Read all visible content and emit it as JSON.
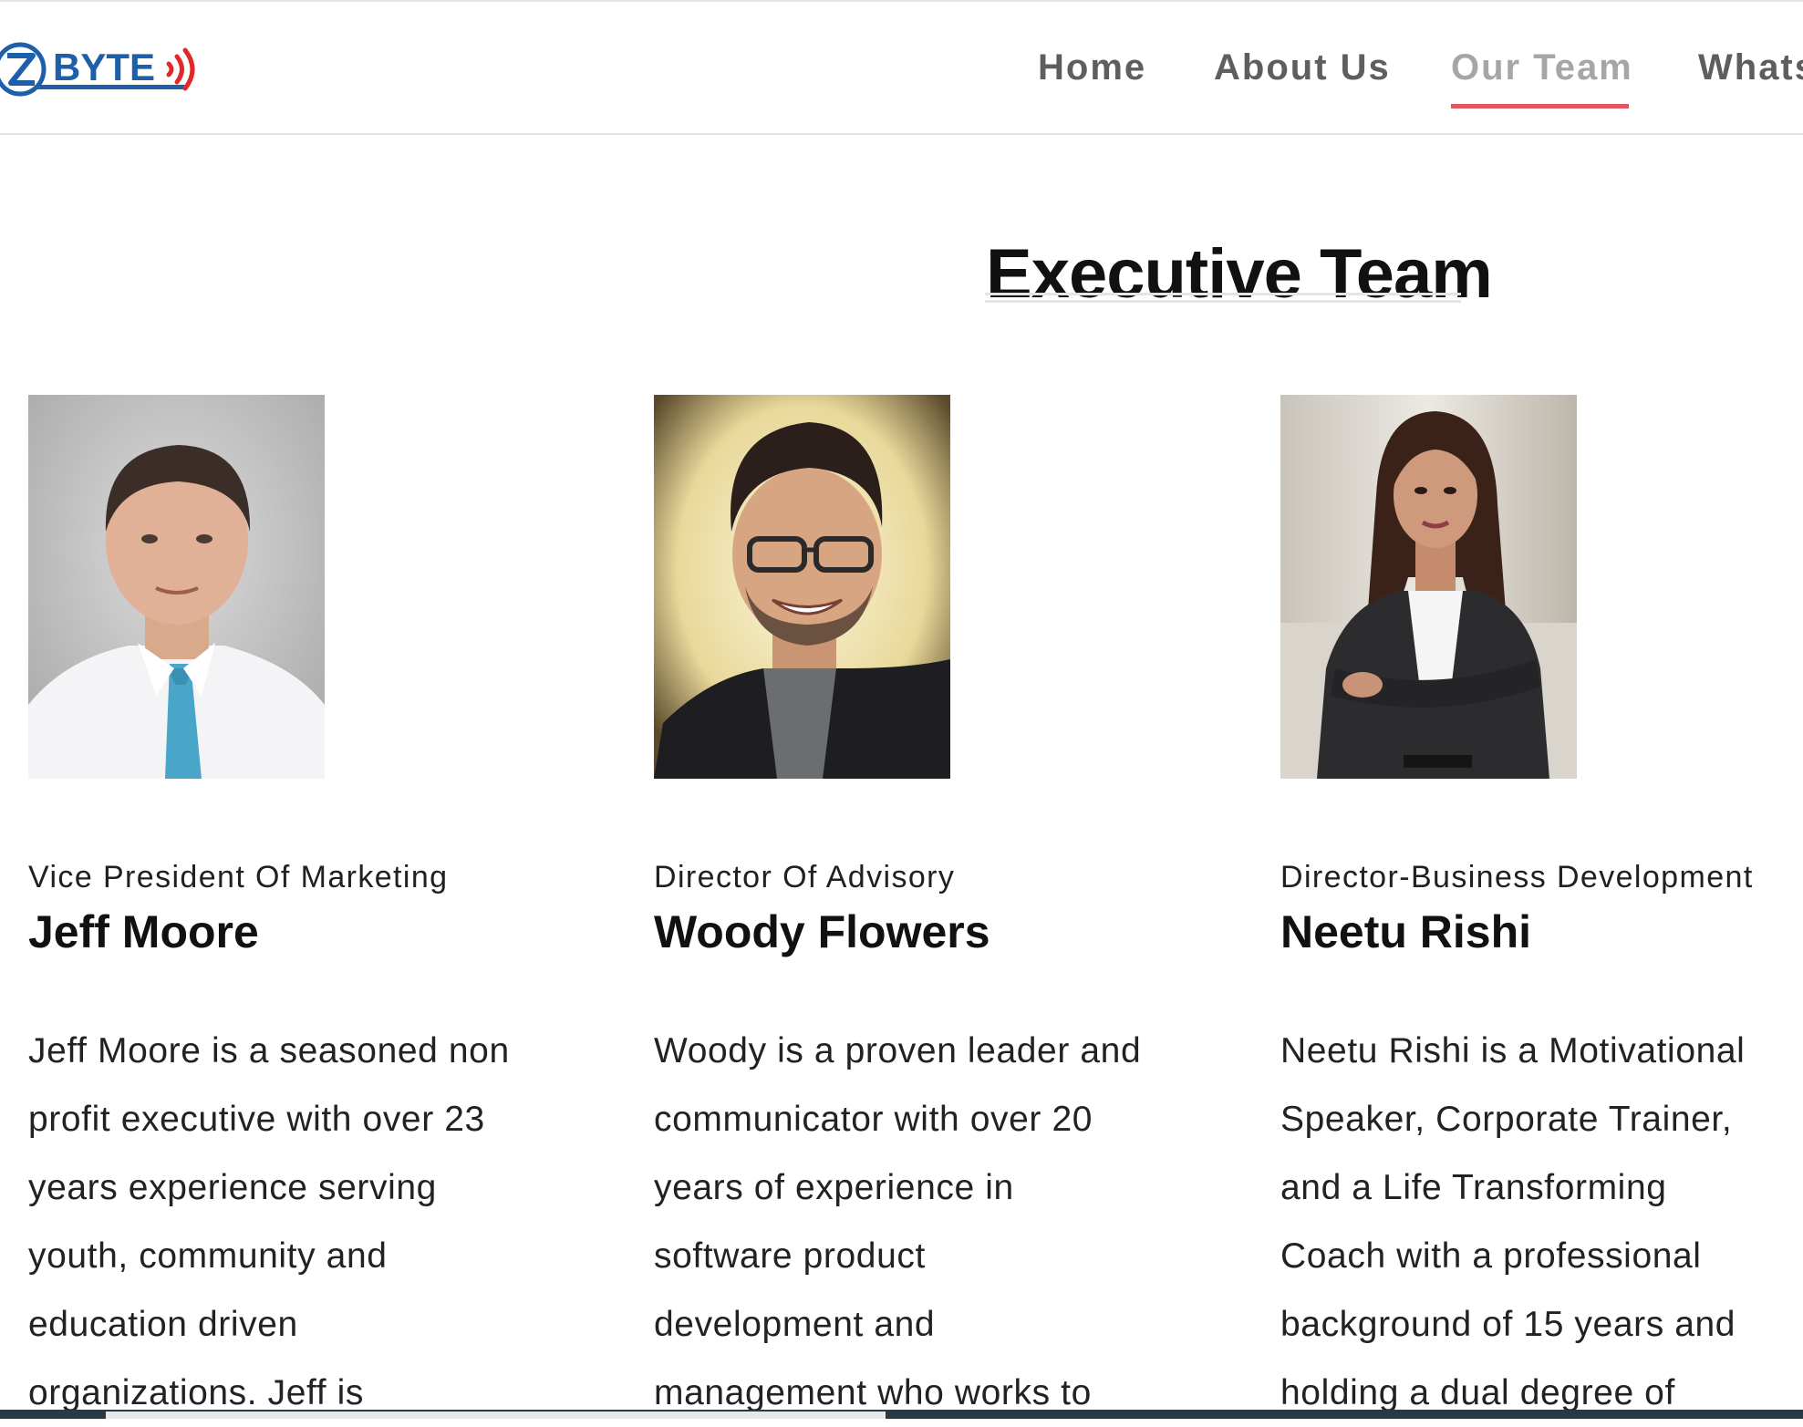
{
  "brand": {
    "logo_text": "BYTE"
  },
  "nav": {
    "items": [
      {
        "label": "Home",
        "active": false
      },
      {
        "label": "About Us",
        "active": false
      },
      {
        "label": "Our Team",
        "active": true
      },
      {
        "label": "Whats",
        "active": false
      }
    ]
  },
  "main": {
    "title": "Executive Team"
  },
  "team": [
    {
      "role": "Vice President Of Marketing",
      "name": "Jeff Moore",
      "bio_lines": [
        "Jeff Moore is a seasoned non",
        "profit executive with over 23",
        "years experience serving",
        "youth, community and",
        "education driven",
        "organizations. Jeff is"
      ]
    },
    {
      "role": "Director Of Advisory",
      "name": "Woody Flowers",
      "bio_lines": [
        "Woody is a proven leader and",
        "communicator with over 20",
        "years of experience in",
        "software product",
        "development and",
        "management who works to"
      ]
    },
    {
      "role": "Director-Business Development",
      "name": "Neetu Rishi",
      "bio_lines": [
        "Neetu Rishi is a Motivational",
        "Speaker, Corporate Trainer,",
        "and a Life Transforming",
        "Coach with a professional",
        "background of 15 years and",
        "holding a dual degree of"
      ]
    }
  ],
  "colors": {
    "accent_underline": "#e25561",
    "nav_text": "#5e5e5e",
    "nav_active_text": "#a6a6a6",
    "logo_blue": "#1d5fa8",
    "logo_red": "#e02a2a",
    "footer_bar": "#263b46"
  }
}
